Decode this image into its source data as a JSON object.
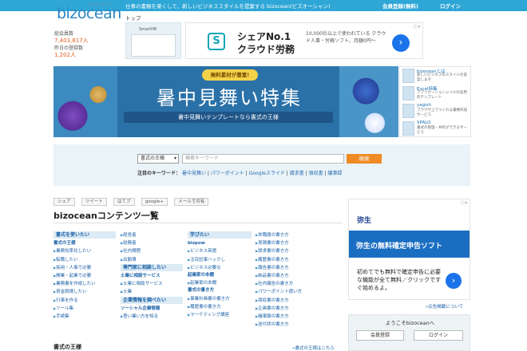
{
  "header": {
    "tagline": "仕事の書類を楽くして、新しいビジネススタイルを提案する bizocean(ビズオーシャン)",
    "register": "会員登録(無料)",
    "login": "ログイン",
    "logo": "bizocean",
    "logo_ruby": "ビズオーシャン",
    "nav_top": "トップ"
  },
  "stats": {
    "members_label": "総会員数",
    "members_value": "7,403,817人",
    "today_label": "昨日の登録数",
    "today_value": "1,202人"
  },
  "ad_top": {
    "smarthr_brand": "SmartHR",
    "icon": "S",
    "headline1": "シェアNo.1",
    "headline2": "クラウド労務",
    "desc": "10,000社以上で使われている クラウド人事・労務ソフト。月額0円〜",
    "go": "›"
  },
  "banner": {
    "ribbon": "無料素材が豊富!",
    "title": "暑中見舞い特集",
    "subtitle": "暑中見舞いテンプレートなら書式の王様"
  },
  "side_ads": [
    {
      "name": "bizoceanとは",
      "text": "新しいビジネスのスタイルを提案します"
    },
    {
      "name": "Excel特集",
      "text": "アプリケーションレベルの実用的テンプレート"
    },
    {
      "name": "yagish",
      "text": "ブラウザ上でつくれる書類作成サービス"
    },
    {
      "name": "SPALO",
      "text": "書式の管理・共有ができるサービス"
    }
  ],
  "search": {
    "select_value": "書式の王様",
    "placeholder": "検索キーワード",
    "button": "検索",
    "kw_label": "注目のキーワード：",
    "keywords": [
      "暑中見舞い",
      "パワーポイント",
      "Googleスライド",
      "請求書",
      "領収書",
      "議事録"
    ]
  },
  "share": [
    "シェア",
    "ツイート",
    "はてブ",
    "google+",
    "メールで共有"
  ],
  "content_title": "bizoceanコンテンツ一覧",
  "columns": {
    "c1_head": "書式を使いたい",
    "c1_sub": "書式の王様",
    "c1_items": [
      "業務効率化したい",
      "転職したい",
      "採用・人事で必要",
      "開業・起業で必要",
      "業務書を作成したい",
      "資金調達したい",
      "行事を作る",
      "ツール集",
      "手続集"
    ],
    "c2_items": [
      "経営者",
      "総務者",
      "社内規程",
      "出勤簿"
    ],
    "c2_head2": "専門家に相談したい",
    "c2_sub2": "士業に相談サービス",
    "c2_items2": [
      "士業に相談サービス",
      "士業"
    ],
    "c2_head3": "企業情報を調べたい",
    "c2_sub3": "ソーシャル企業情報",
    "c2_items3": [
      "登い業い方を知る"
    ],
    "c3_head": "学びたい",
    "c3_sub": "bizpow",
    "c3_items": [
      "ビジネス英語",
      "注目記事ハックし",
      "ビジネス必要な"
    ],
    "c3_sub2": "起業家の本棚",
    "c3_items2": [
      "起業家の本棚"
    ],
    "c3_sub3": "書式の書き方",
    "c3_items3": [
      "事業計画書の書き方",
      "履歴書の書き方",
      "マーケティング講座"
    ],
    "c4_items": [
      "休職届の書き方",
      "見積書の書き方",
      "請求書の書き方",
      "履歴書の書き方",
      "報告書の書き方",
      "納品書の書き方",
      "社内報告の書き方",
      "パワーポイント使い方",
      "領収書の書き方",
      "企画書の書き方",
      "議事録の書き方",
      "送付状の書き方"
    ]
  },
  "bottom": {
    "title": "書式の王様",
    "link": "»書式の王様はこちら"
  },
  "right_ad": {
    "brand": "弥生",
    "banner": "弥生の無料確定申告ソフト",
    "msg": "初めてでも無料で確定申告に必要な機能が全て無料／クリックですぐ始めるよ。",
    "go": "›",
    "note": "»広告掲載について"
  },
  "welcome": {
    "text": "ようこそbizoceanへ",
    "register": "会員登録",
    "login": "ログイン"
  },
  "colors": {
    "topbar": "#2ea6d6",
    "accent_orange": "#f08a24",
    "link": "#1a5fa6"
  }
}
